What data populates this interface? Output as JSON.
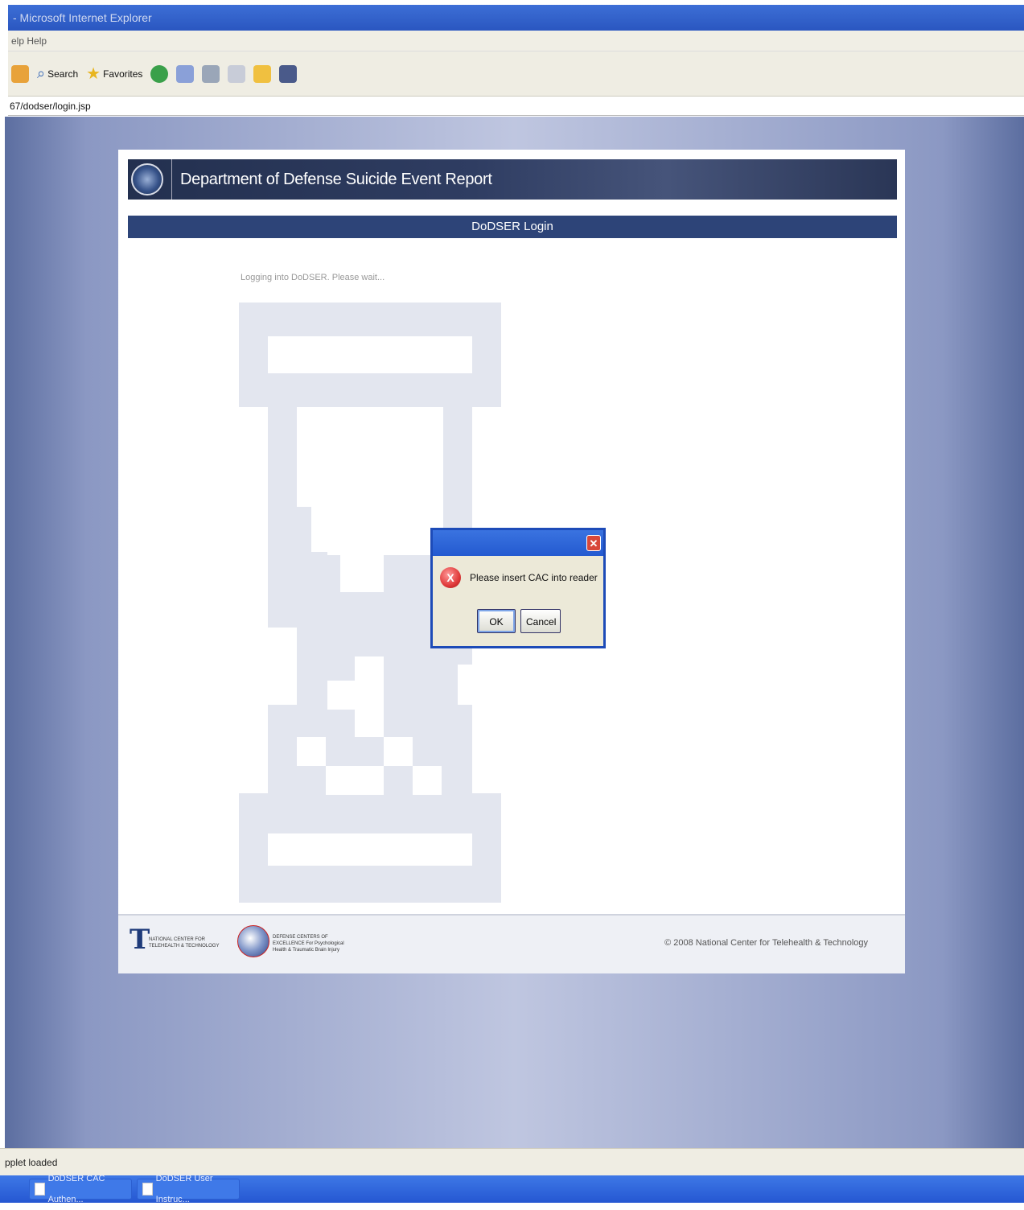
{
  "browser": {
    "title": "- Microsoft Internet Explorer",
    "menu": "elp  Help",
    "toolbar": {
      "search_label": "Search",
      "favorites_label": "Favorites"
    },
    "address": "67/dodser/login.jsp",
    "status": "pplet loaded"
  },
  "page": {
    "header_title": "Department of Defense Suicide Event Report",
    "login_bar": "DoDSER Login",
    "loading_text": "Logging into DoDSER. Please wait...",
    "footer": {
      "logo_ncttt": "NATIONAL CENTER FOR TELEHEALTH & TECHNOLOGY",
      "logo_dcoe": "DEFENSE CENTERS OF EXCELLENCE For Psychological Health & Traumatic Brain Injury",
      "copyright": "© 2008 National Center for Telehealth & Technology"
    }
  },
  "dialog": {
    "message": "Please insert CAC into reader",
    "ok_label": "OK",
    "cancel_label": "Cancel",
    "icon": "error-icon"
  },
  "taskbar": {
    "items": [
      "DoDSER CAC Authen...",
      "DoDSER User Instruc..."
    ]
  },
  "colors": {
    "header_navy": "#23304f",
    "login_bar": "#2d4478",
    "dialog_border": "#1d4bb8",
    "taskbar_blue": "#2557d2"
  }
}
